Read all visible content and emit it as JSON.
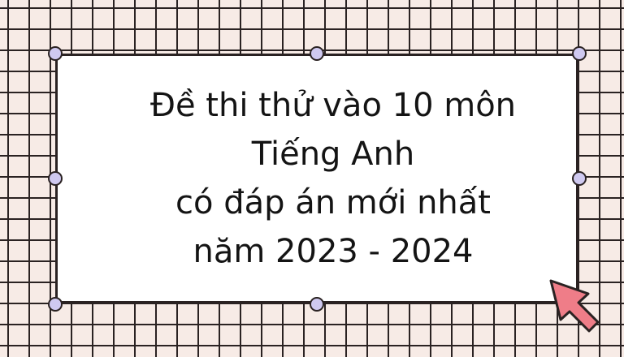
{
  "title": {
    "line1": "Đề thi thử vào 10 môn",
    "line2": "Tiếng Anh",
    "line3": "có đáp án mới nhất",
    "line4": "năm 2023 - 2024"
  },
  "colors": {
    "background": "#f7ebe6",
    "grid": "#2a2222",
    "card": "#ffffff",
    "handle": "#cfc9f0",
    "cursor": "#ef7d88"
  },
  "icons": {
    "handles": "circle-handle",
    "cursor": "arrow-cursor-icon"
  }
}
